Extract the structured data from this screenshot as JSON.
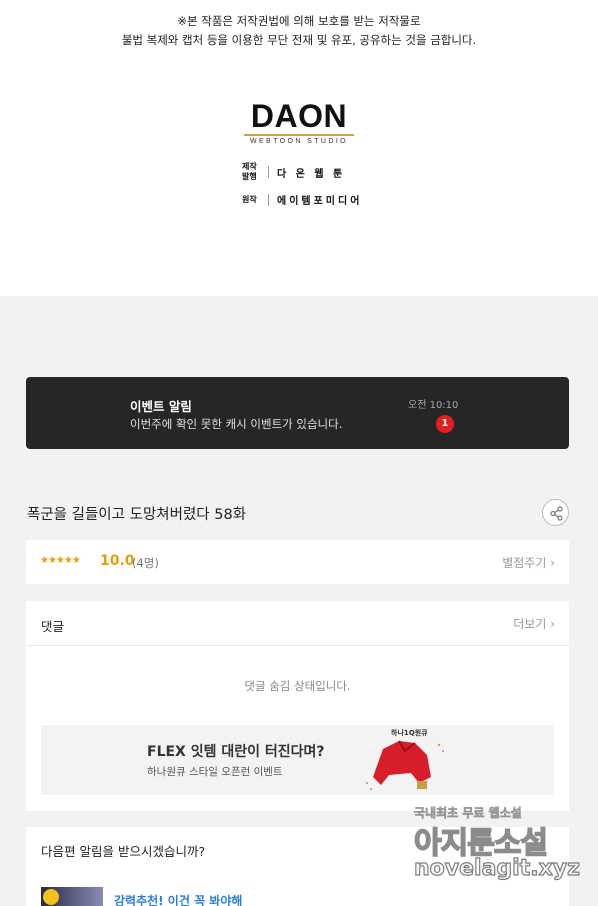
{
  "notice": {
    "line1": "※본 작품은 저작권법에 의해 보호를 받는 저작물로",
    "line2": "불법 복제와 캡처 등을 이용한 무단 전재 및 유포, 공유하는 것을 금합니다."
  },
  "logo": {
    "main": "DAON",
    "sub": "WEBTOON STUDIO"
  },
  "credits": [
    {
      "key": "제작\n발행",
      "value": "다 온 웹 툰"
    },
    {
      "key": "원작",
      "value": "에이템포미디어"
    }
  ],
  "toast": {
    "title": "이벤트 알림",
    "body": "이번주에 확인 못한 캐시 이벤트가 있습니다.",
    "time": "오전 10:10",
    "badge": "1"
  },
  "episode": {
    "title": "폭군을 길들이고 도망쳐버렸다 58화"
  },
  "rating": {
    "stars": "★★★★★",
    "value": "10.0",
    "count": "(4명)",
    "rate_link": "별점주기 ›"
  },
  "comments": {
    "title": "댓글",
    "more": "더보기 ›",
    "hidden_msg": "댓글 숨김 상태입니다."
  },
  "ad": {
    "title": "FLEX 잇템 대란이 터진다며?",
    "subtitle": "하나원큐 스타일 오픈런 이벤트",
    "brand": "하나1Q원큐"
  },
  "next": {
    "question": "다음편 알림을 받으시겠습니까?",
    "recommend": "강력추천! 이건 꼭 봐야해"
  },
  "watermark": {
    "line1": "국내최초 무료 웹소설",
    "line2": "아지툰소설",
    "line3": "novelagit.xyz"
  },
  "colors": {
    "accent_gold": "#e0a010",
    "badge_red": "#e02020",
    "link_blue": "#2a7de1",
    "toast_bg": "#262626"
  }
}
